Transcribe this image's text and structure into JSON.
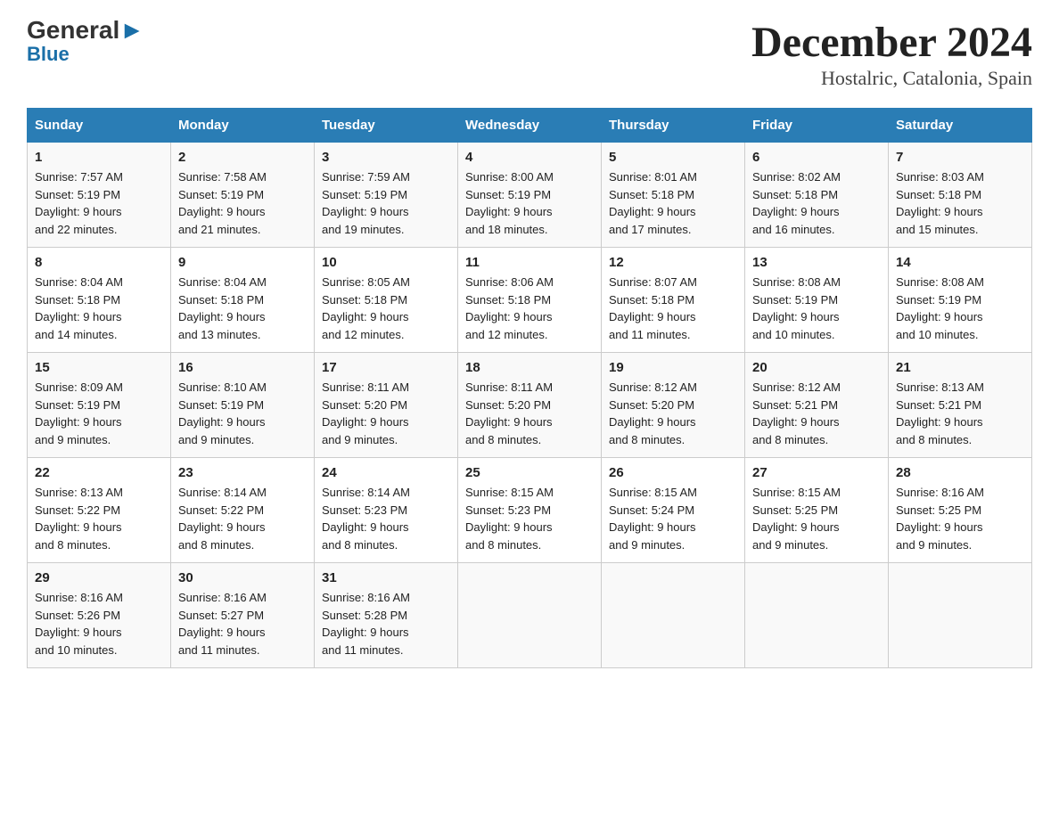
{
  "logo": {
    "general": "General",
    "blue": "Blue",
    "arrow": "▶"
  },
  "title": "December 2024",
  "subtitle": "Hostalric, Catalonia, Spain",
  "days_of_week": [
    "Sunday",
    "Monday",
    "Tuesday",
    "Wednesday",
    "Thursday",
    "Friday",
    "Saturday"
  ],
  "weeks": [
    [
      {
        "day": "1",
        "sunrise": "7:57 AM",
        "sunset": "5:19 PM",
        "daylight": "9 hours and 22 minutes."
      },
      {
        "day": "2",
        "sunrise": "7:58 AM",
        "sunset": "5:19 PM",
        "daylight": "9 hours and 21 minutes."
      },
      {
        "day": "3",
        "sunrise": "7:59 AM",
        "sunset": "5:19 PM",
        "daylight": "9 hours and 19 minutes."
      },
      {
        "day": "4",
        "sunrise": "8:00 AM",
        "sunset": "5:19 PM",
        "daylight": "9 hours and 18 minutes."
      },
      {
        "day": "5",
        "sunrise": "8:01 AM",
        "sunset": "5:18 PM",
        "daylight": "9 hours and 17 minutes."
      },
      {
        "day": "6",
        "sunrise": "8:02 AM",
        "sunset": "5:18 PM",
        "daylight": "9 hours and 16 minutes."
      },
      {
        "day": "7",
        "sunrise": "8:03 AM",
        "sunset": "5:18 PM",
        "daylight": "9 hours and 15 minutes."
      }
    ],
    [
      {
        "day": "8",
        "sunrise": "8:04 AM",
        "sunset": "5:18 PM",
        "daylight": "9 hours and 14 minutes."
      },
      {
        "day": "9",
        "sunrise": "8:04 AM",
        "sunset": "5:18 PM",
        "daylight": "9 hours and 13 minutes."
      },
      {
        "day": "10",
        "sunrise": "8:05 AM",
        "sunset": "5:18 PM",
        "daylight": "9 hours and 12 minutes."
      },
      {
        "day": "11",
        "sunrise": "8:06 AM",
        "sunset": "5:18 PM",
        "daylight": "9 hours and 12 minutes."
      },
      {
        "day": "12",
        "sunrise": "8:07 AM",
        "sunset": "5:18 PM",
        "daylight": "9 hours and 11 minutes."
      },
      {
        "day": "13",
        "sunrise": "8:08 AM",
        "sunset": "5:19 PM",
        "daylight": "9 hours and 10 minutes."
      },
      {
        "day": "14",
        "sunrise": "8:08 AM",
        "sunset": "5:19 PM",
        "daylight": "9 hours and 10 minutes."
      }
    ],
    [
      {
        "day": "15",
        "sunrise": "8:09 AM",
        "sunset": "5:19 PM",
        "daylight": "9 hours and 9 minutes."
      },
      {
        "day": "16",
        "sunrise": "8:10 AM",
        "sunset": "5:19 PM",
        "daylight": "9 hours and 9 minutes."
      },
      {
        "day": "17",
        "sunrise": "8:11 AM",
        "sunset": "5:20 PM",
        "daylight": "9 hours and 9 minutes."
      },
      {
        "day": "18",
        "sunrise": "8:11 AM",
        "sunset": "5:20 PM",
        "daylight": "9 hours and 8 minutes."
      },
      {
        "day": "19",
        "sunrise": "8:12 AM",
        "sunset": "5:20 PM",
        "daylight": "9 hours and 8 minutes."
      },
      {
        "day": "20",
        "sunrise": "8:12 AM",
        "sunset": "5:21 PM",
        "daylight": "9 hours and 8 minutes."
      },
      {
        "day": "21",
        "sunrise": "8:13 AM",
        "sunset": "5:21 PM",
        "daylight": "9 hours and 8 minutes."
      }
    ],
    [
      {
        "day": "22",
        "sunrise": "8:13 AM",
        "sunset": "5:22 PM",
        "daylight": "9 hours and 8 minutes."
      },
      {
        "day": "23",
        "sunrise": "8:14 AM",
        "sunset": "5:22 PM",
        "daylight": "9 hours and 8 minutes."
      },
      {
        "day": "24",
        "sunrise": "8:14 AM",
        "sunset": "5:23 PM",
        "daylight": "9 hours and 8 minutes."
      },
      {
        "day": "25",
        "sunrise": "8:15 AM",
        "sunset": "5:23 PM",
        "daylight": "9 hours and 8 minutes."
      },
      {
        "day": "26",
        "sunrise": "8:15 AM",
        "sunset": "5:24 PM",
        "daylight": "9 hours and 9 minutes."
      },
      {
        "day": "27",
        "sunrise": "8:15 AM",
        "sunset": "5:25 PM",
        "daylight": "9 hours and 9 minutes."
      },
      {
        "day": "28",
        "sunrise": "8:16 AM",
        "sunset": "5:25 PM",
        "daylight": "9 hours and 9 minutes."
      }
    ],
    [
      {
        "day": "29",
        "sunrise": "8:16 AM",
        "sunset": "5:26 PM",
        "daylight": "9 hours and 10 minutes."
      },
      {
        "day": "30",
        "sunrise": "8:16 AM",
        "sunset": "5:27 PM",
        "daylight": "9 hours and 11 minutes."
      },
      {
        "day": "31",
        "sunrise": "8:16 AM",
        "sunset": "5:28 PM",
        "daylight": "9 hours and 11 minutes."
      },
      null,
      null,
      null,
      null
    ]
  ]
}
